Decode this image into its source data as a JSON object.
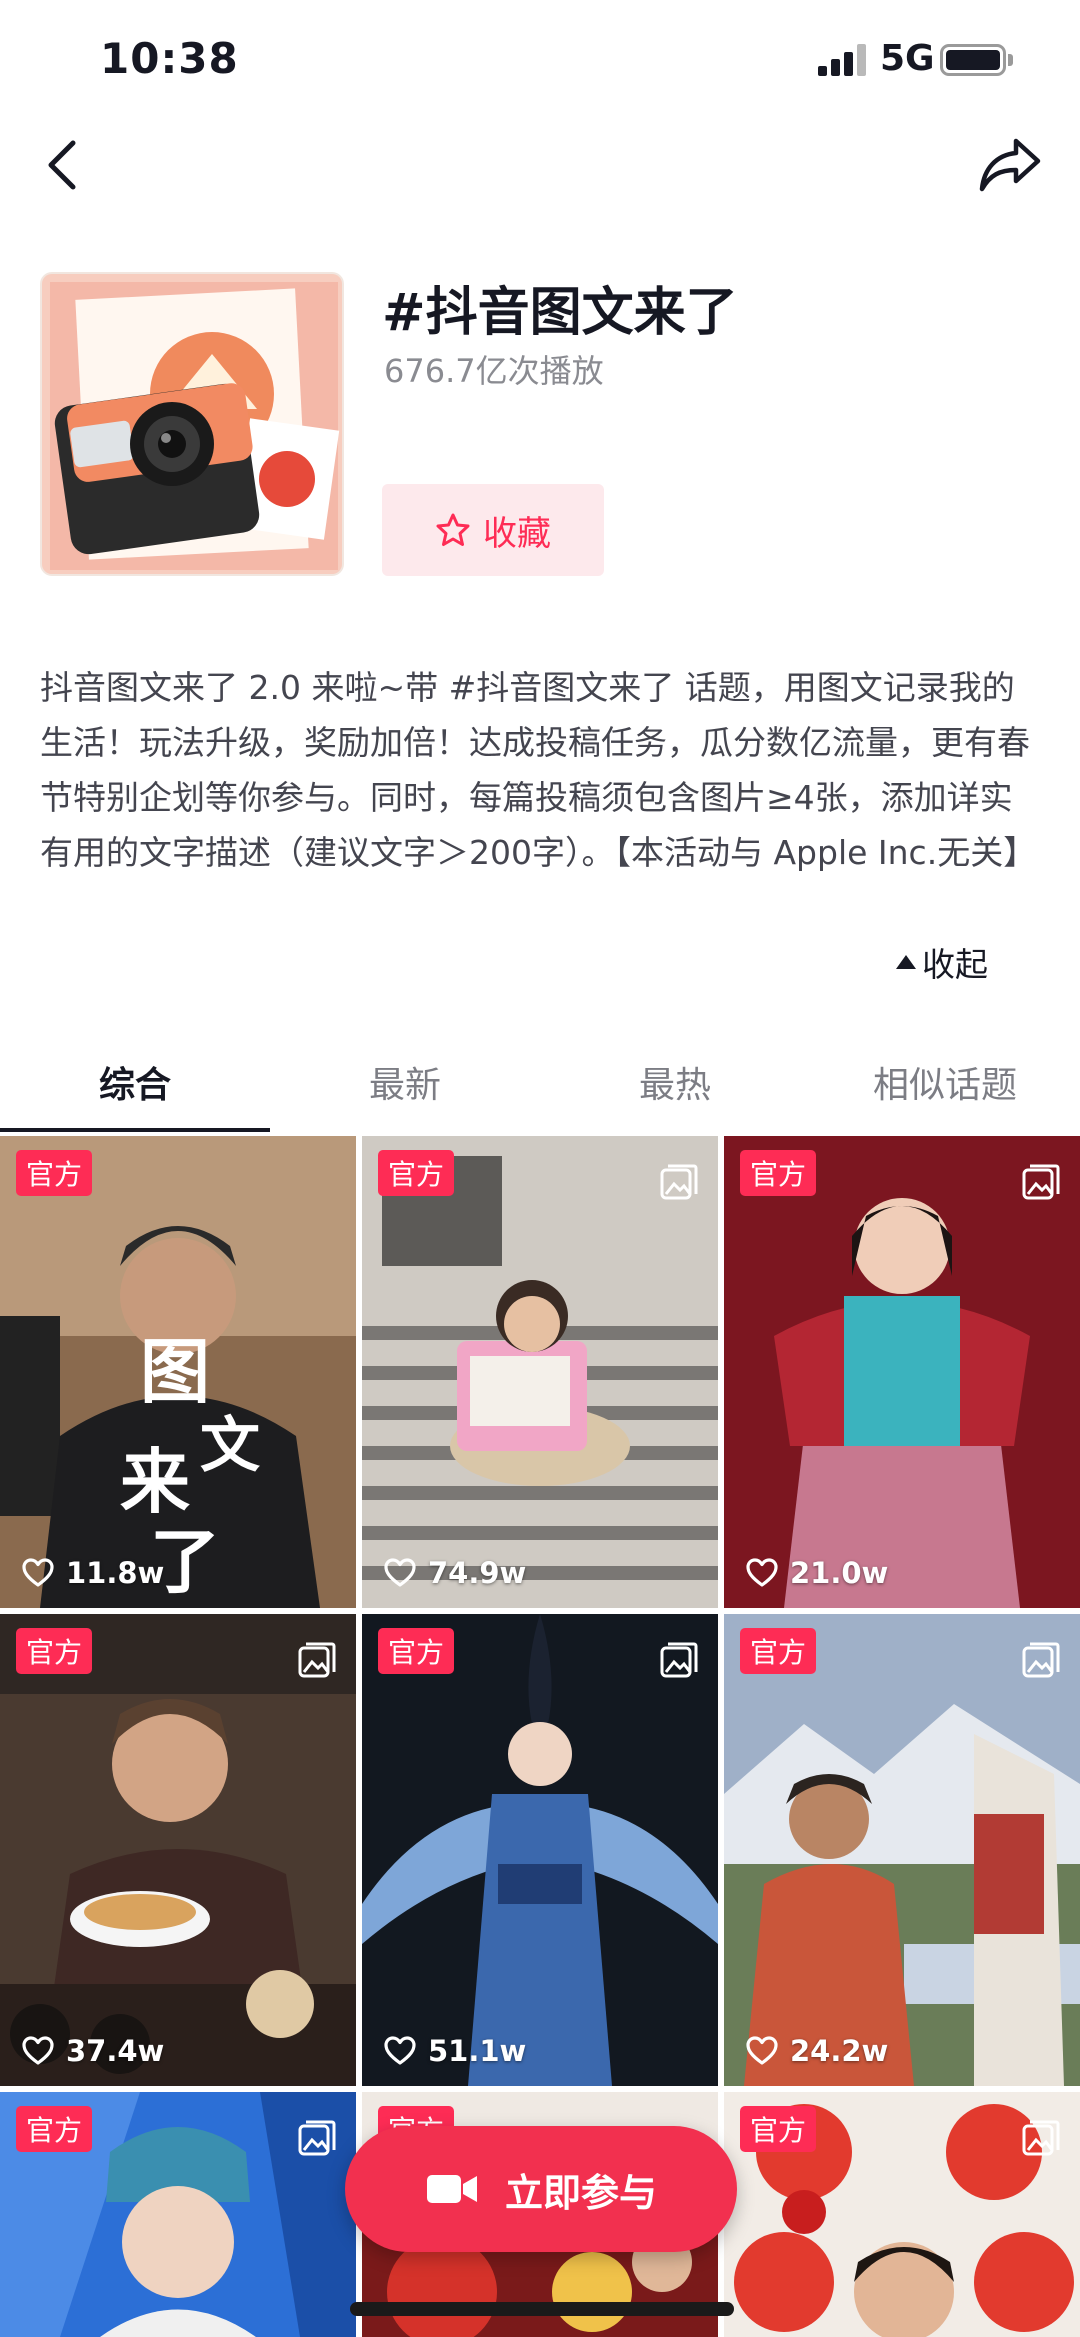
{
  "status_bar": {
    "time": "10:38",
    "network": "5G"
  },
  "topic": {
    "title": "#抖音图文来了",
    "plays": "676.7亿次播放",
    "favorite_label": "收藏",
    "description": "抖音图文来了 2.0 来啦~带 #抖音图文来了 话题，用图文记录我的生活！玩法升级，奖励加倍！达成投稿任务，瓜分数亿流量，更有春节特别企划等你参与。同时，每篇投稿须包含图片≥4张，添加详实有用的文字描述（建议文字＞200字）。【本活动与 Apple Inc.无关】",
    "collapse_label": "收起"
  },
  "tabs": [
    {
      "label": "综合",
      "active": true
    },
    {
      "label": "最新",
      "active": false
    },
    {
      "label": "最热",
      "active": false
    },
    {
      "label": "相似话题",
      "active": false
    }
  ],
  "posts": [
    {
      "badge": "官方",
      "likes": "11.8w",
      "multi_image": false
    },
    {
      "badge": "官方",
      "likes": "74.9w",
      "multi_image": true
    },
    {
      "badge": "官方",
      "likes": "21.0w",
      "multi_image": true
    },
    {
      "badge": "官方",
      "likes": "37.4w",
      "multi_image": true
    },
    {
      "badge": "官方",
      "likes": "51.1w",
      "multi_image": true
    },
    {
      "badge": "官方",
      "likes": "24.2w",
      "multi_image": true
    },
    {
      "badge": "官方",
      "likes": "",
      "multi_image": true
    },
    {
      "badge": "官方",
      "likes": "",
      "multi_image": false
    },
    {
      "badge": "官方",
      "likes": "",
      "multi_image": true
    }
  ],
  "join_button": {
    "label": "立即参与"
  },
  "colors": {
    "accent": "#fe2c55",
    "text": "#161823",
    "muted": "#8a8b91"
  }
}
